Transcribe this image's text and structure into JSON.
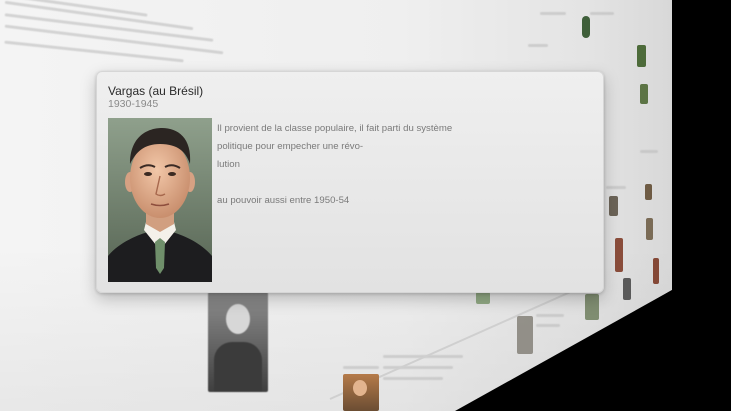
{
  "popup": {
    "title": "Vargas (au Brésil)",
    "subtitle": "1930-1945",
    "description_lines": [
      "Il provient de la classe populaire, il fait parti du système politique pour empecher une révo-",
      "lution",
      "au pouvoir aussi entre 1950-54"
    ],
    "portrait_icon": "person-portrait-icon"
  },
  "colors": {
    "card_bg": "#e8e8e8",
    "title_text": "#2a2a2a",
    "subtitle_text": "#8a8a8a",
    "body_text": "#7a7a7a",
    "background_wall": "#f0f0f0",
    "side_black": "#000000"
  }
}
